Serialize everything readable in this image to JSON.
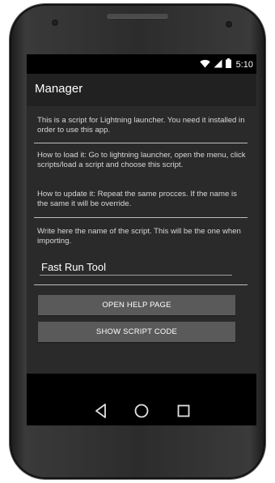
{
  "status_bar": {
    "time": "5:10",
    "icons": [
      "wifi-icon",
      "signal-icon",
      "battery-icon"
    ]
  },
  "app_bar": {
    "title": "Manager"
  },
  "content": {
    "intro": "This is a script for Lightning launcher. You need it installed in order to use this app.",
    "how_to_load": "How to load it: Go to lightning launcher, open the menu, click scripts/load a script and choose this script.",
    "how_to_update": "How to update it: Repeat the same procces. If the name is the same it will be override.",
    "name_hint": "Write here the name of the script. This will be the one when importing.",
    "script_name_value": "Fast Run Tool",
    "open_help_label": "OPEN HELP PAGE",
    "show_code_label": "SHOW SCRIPT CODE"
  },
  "nav_bar": {
    "buttons": [
      "back-icon",
      "home-icon",
      "recents-icon"
    ]
  },
  "colors": {
    "appbar": "#212121",
    "content_bg": "#2a2a2a",
    "button_bg": "#5a5a5a",
    "text": "#d8d8d8"
  }
}
